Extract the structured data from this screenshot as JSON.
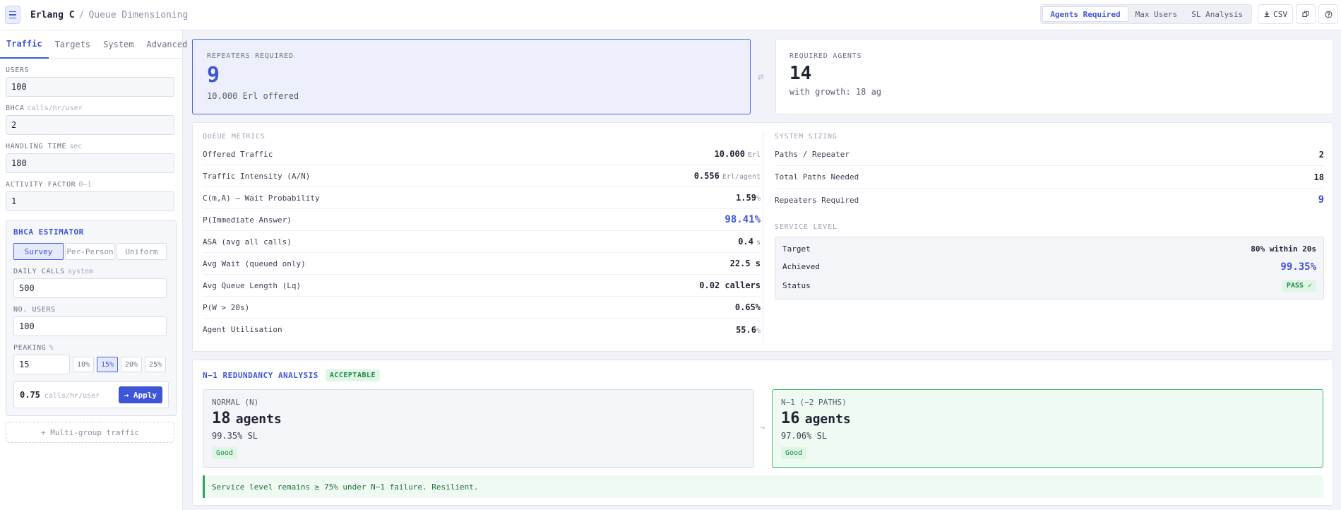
{
  "header": {
    "menu_icon": "hamburger-icon",
    "title": "Erlang C",
    "separator": "/",
    "breadcrumb": "Queue Dimensioning",
    "modes": [
      {
        "label": "Agents Required",
        "active": true
      },
      {
        "label": "Max Users",
        "active": false
      },
      {
        "label": "SL Analysis",
        "active": false
      }
    ],
    "csv_label": "CSV",
    "download_icon": "download-icon",
    "copy_icon": "copy-icon",
    "help_icon": "help-icon"
  },
  "sidebar": {
    "tabs": [
      {
        "label": "Traffic",
        "active": true
      },
      {
        "label": "Targets",
        "active": false
      },
      {
        "label": "System",
        "active": false
      },
      {
        "label": "Advanced",
        "active": false
      }
    ],
    "users": {
      "label": "USERS",
      "unit": "",
      "value": "100"
    },
    "bhca": {
      "label": "BHCA",
      "unit": "calls/hr/user",
      "value": "2"
    },
    "handling_time": {
      "label": "HANDLING TIME",
      "unit": "sec",
      "value": "180"
    },
    "activity_factor": {
      "label": "ACTIVITY FACTOR",
      "unit": "0–1",
      "value": "1"
    },
    "estimator": {
      "title": "BHCA ESTIMATOR",
      "options": [
        {
          "label": "Survey",
          "active": true
        },
        {
          "label": "Per-Person",
          "active": false
        },
        {
          "label": "Uniform",
          "active": false
        }
      ],
      "daily_calls": {
        "label": "DAILY CALLS",
        "unit": "system",
        "value": "500"
      },
      "no_users": {
        "label": "NO. USERS",
        "unit": "",
        "value": "100"
      },
      "peaking": {
        "label": "PEAKING",
        "unit": "%",
        "value": "15"
      },
      "peak_chips": [
        {
          "label": "10%",
          "active": false
        },
        {
          "label": "15%",
          "active": true
        },
        {
          "label": "20%",
          "active": false
        },
        {
          "label": "25%",
          "active": false
        }
      ],
      "result_value": "0.75",
      "result_unit": "calls/hr/user",
      "apply_label": "→ Apply"
    },
    "multi_group_label": "+ Multi-group traffic"
  },
  "kpi": {
    "repeaters": {
      "label": "REPEATERS REQUIRED",
      "value": "9",
      "sub": "10.000 Erl offered"
    },
    "swap_icon": "swap-arrows-icon",
    "agents": {
      "label": "REQUIRED AGENTS",
      "value": "14",
      "sub": "with growth: 18 ag"
    }
  },
  "queue_metrics": {
    "title": "QUEUE METRICS",
    "rows": [
      {
        "label": "Offered Traffic",
        "value": "10.000",
        "unit": "Erl",
        "highlight": false
      },
      {
        "label": "Traffic Intensity (A/N)",
        "value": "0.556",
        "unit": "Erl/agent",
        "highlight": false
      },
      {
        "label": "C(m,A) — Wait Probability",
        "value": "1.59",
        "unit": "%",
        "highlight": false
      },
      {
        "label": "P(Immediate Answer)",
        "value": "98.41%",
        "unit": "",
        "highlight": true
      },
      {
        "label": "ASA (avg all calls)",
        "value": "0.4",
        "unit": "s",
        "highlight": false
      },
      {
        "label": "Avg Wait (queued only)",
        "value": "22.5 s",
        "unit": "",
        "highlight": false
      },
      {
        "label": "Avg Queue Length (Lq)",
        "value": "0.02 callers",
        "unit": "",
        "highlight": false
      },
      {
        "label": "P(W > 20s)",
        "value": "0.65%",
        "unit": "",
        "highlight": false
      },
      {
        "label": "Agent Utilisation",
        "value": "55.6",
        "unit": "%",
        "highlight": false
      }
    ]
  },
  "system_sizing": {
    "title": "SYSTEM SIZING",
    "rows": [
      {
        "label": "Paths / Repeater",
        "value": "2"
      },
      {
        "label": "Total Paths Needed",
        "value": "18"
      },
      {
        "label": "Repeaters Required",
        "value": "9"
      }
    ]
  },
  "service_level": {
    "title": "SERVICE LEVEL",
    "target_label": "Target",
    "target_value": "80% within 20s",
    "achieved_label": "Achieved",
    "achieved_value": "99.35%",
    "status_label": "Status",
    "status_value": "PASS ✓"
  },
  "redundancy": {
    "title": "N−1 REDUNDANCY ANALYSIS",
    "badge": "ACCEPTABLE",
    "normal": {
      "label": "NORMAL (N)",
      "value": "18",
      "unit": "agents",
      "sl": "99.35% SL",
      "grade": "Good"
    },
    "arrow_icon": "arrow-right-icon",
    "n1": {
      "label": "N−1 (−2 PATHS)",
      "value": "16",
      "unit": "agents",
      "sl": "97.06% SL",
      "grade": "Good"
    },
    "message": "Service level remains ≥ 75% under N−1 failure. Resilient."
  },
  "colors": {
    "accent": "#3e55d8",
    "success": "#1f8a44",
    "success_bg": "#dff5e6"
  }
}
